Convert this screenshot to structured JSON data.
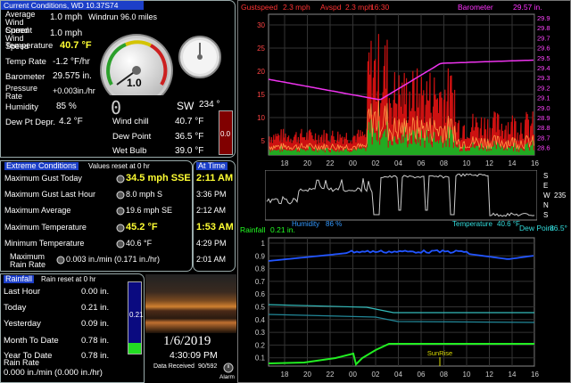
{
  "current": {
    "title": "Current Conditions, WD 10.37S74",
    "avg_wind_label": "Average Wind Speed",
    "avg_wind_value": "1.0 mph",
    "windrun": "Windrun 96.0 miles",
    "cur_wind_label": "Current Wind Speed",
    "cur_wind_value": "1.0 mph",
    "temp_label": "Temperature",
    "temp_value": "40.7 °F",
    "temprate_label": "Temp Rate",
    "temprate_value": "-1.2 °F/hr",
    "baro_label": "Barometer",
    "baro_value": "29.575 in.",
    "pressrate_label": "Pressure Rate",
    "pressrate_value": "+0.003in./hr",
    "humidity_label": "Humidity",
    "humidity_value": "85 %",
    "dewdepr_label": "Dew Pt Depr.",
    "dewdepr_value": "4.2 °F",
    "gauge_value": "1.0",
    "wind_dir": "SW",
    "wind_deg": "234 °",
    "digits": "0",
    "windchill_label": "Wind chill",
    "windchill_value": "40.7 °F",
    "dewpoint_label": "Dew Point",
    "dewpoint_value": "36.5 °F",
    "wetbulb_label": "Wet Bulb",
    "wetbulb_value": "39.0 °F",
    "bar_value": "0.0"
  },
  "extreme": {
    "title": "Extreme Conditions",
    "subtitle": "Values reset at 0 hr",
    "rows": [
      {
        "label": "Maximum Gust Today",
        "value": "34.5 mph SSE"
      },
      {
        "label": "Maximum Gust Last Hour",
        "value": "8.0 mph   S"
      },
      {
        "label": "Maximum Average",
        "value": "19.6 mph  SE"
      },
      {
        "label": "Maximum Temperature",
        "value": "45.2 °F"
      },
      {
        "label": "Minimum Temperature",
        "value": "40.6 °F"
      },
      {
        "label": "Maximum Rain Rate",
        "value": "0.003 in./min (0.171 in./hr)"
      }
    ]
  },
  "attime": {
    "title": "At Time",
    "times": [
      "2:11 AM",
      "3:36 PM",
      "2:12 AM",
      "1:53 AM",
      "4:29 PM",
      "2:01 AM"
    ]
  },
  "rainfall": {
    "title": "Rainfall",
    "subtitle": "Rain reset at 0 hr",
    "rows": [
      {
        "label": "Last Hour",
        "value": "0.00 in."
      },
      {
        "label": "Today",
        "value": "0.21 in."
      },
      {
        "label": "Yesterday",
        "value": "0.09 in."
      },
      {
        "label": "Month To Date",
        "value": "0.78 in."
      },
      {
        "label": "Year To Date",
        "value": "0.78 in."
      }
    ],
    "rate_label": "Rain Rate",
    "rate_value": "0.000 in./min (0.000 in./hr)",
    "bar_value": "0.21"
  },
  "photo": {
    "date": "1/6/2019",
    "time": "4:30:09 PM",
    "received_label": "Data Received",
    "received_value": "90/592",
    "alarm": "Alarm"
  },
  "chart_top": {
    "gust_label": "Gustspeed",
    "gust_value": "2.3 mph",
    "avg_label": "Avspd",
    "avg_value": "2.3 mph",
    "time": "16:30",
    "baro_label": "Barometer",
    "baro_value": "29.57 in.",
    "yleft": [
      30,
      25,
      20,
      15,
      10,
      5
    ],
    "yright": [
      "29.9",
      "29.8",
      "29.7",
      "29.6",
      "29.5",
      "29.4",
      "29.3",
      "29.2",
      "29.1",
      "29.0",
      "28.9",
      "28.8",
      "28.7",
      "28.6"
    ],
    "xticks": [
      "18",
      "20",
      "22",
      "00",
      "02",
      "04",
      "06",
      "08",
      "10",
      "12",
      "14",
      "16"
    ]
  },
  "chart_mid": {
    "humidity_label": "Humidity",
    "humidity_value": "86 %",
    "temp_label": "Temperature",
    "temp_value": "40.6 °F",
    "compass": [
      "S",
      "E",
      "W",
      "N",
      "S"
    ],
    "deg": "235"
  },
  "chart_bot": {
    "rain_label": "Rainfall",
    "rain_value": "0.21 in.",
    "dew_label": "Dew Point",
    "dew_value": "86.5°",
    "yticks": [
      "1",
      "0.9",
      "0.8",
      "0.7",
      "0.6",
      "0.5",
      "0.4",
      "0.3",
      "0.2",
      "0.1"
    ],
    "xticks": [
      "18",
      "20",
      "22",
      "00",
      "02",
      "04",
      "06",
      "08",
      "10",
      "12",
      "14",
      "16"
    ],
    "sunrise": "SunRise"
  }
}
